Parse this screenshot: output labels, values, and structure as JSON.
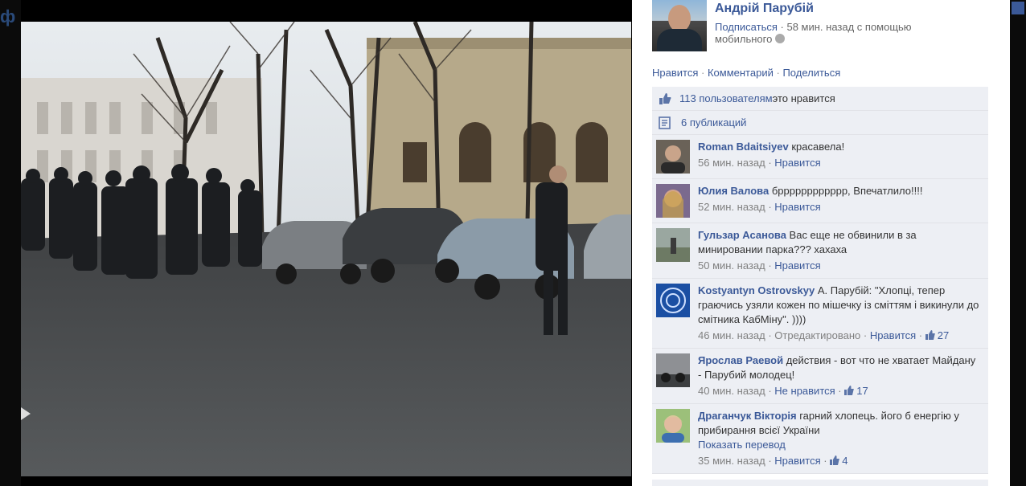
{
  "side_peek": "ф",
  "author": {
    "name": "Андрій Парубій",
    "subscribe": "Подписаться",
    "time": "58 мин. назад с помощью мобильного"
  },
  "actions": {
    "like": "Нравится",
    "comment": "Комментарий",
    "share": "Поделиться",
    "sep": "·"
  },
  "likes": {
    "count_text": "113 пользователям",
    "suffix": " это нравится"
  },
  "shares": {
    "text": "6 публикаций"
  },
  "comments": [
    {
      "name": "Roman Bdaitsiyev",
      "text": " красавела!",
      "time": "56 мин. назад",
      "like": "Нравится"
    },
    {
      "name": "Юлия Валова",
      "text": " брррррррррррр, Впечатлило!!!!",
      "time": "52 мин. назад",
      "like": "Нравится"
    },
    {
      "name": "Гульзар Асанова",
      "text": " Вас еще не обвинили в за минировании парка??? хахаха",
      "time": "50 мин. назад",
      "like": "Нравится"
    },
    {
      "name": "Kostyantyn Ostrovskyy",
      "text": " А. Парубій: \"Хлопці, тепер граючись узяли кожен по мішечку із сміттям і викинули до смітника КабМіну\". ))))",
      "time": "46 мин. назад",
      "edited": "Отредактировано",
      "like": "Нравится",
      "likes": "27"
    },
    {
      "name": "Ярослав Раевой",
      "text": " действия - вот что не хватает Майдану - Парубий молодец!",
      "time": "40 мин. назад",
      "like": "Не нравится",
      "likes": "17"
    },
    {
      "name": "Драганчук Вікторія",
      "text": " гарний хлопець. його б енергію у прибирання всієї України",
      "translate": "Показать перевод",
      "time": "35 мин. назад",
      "like": "Нравится",
      "likes": "4"
    }
  ],
  "colors": {
    "link": "#3b5998",
    "ufi_bg": "#edeff4"
  }
}
